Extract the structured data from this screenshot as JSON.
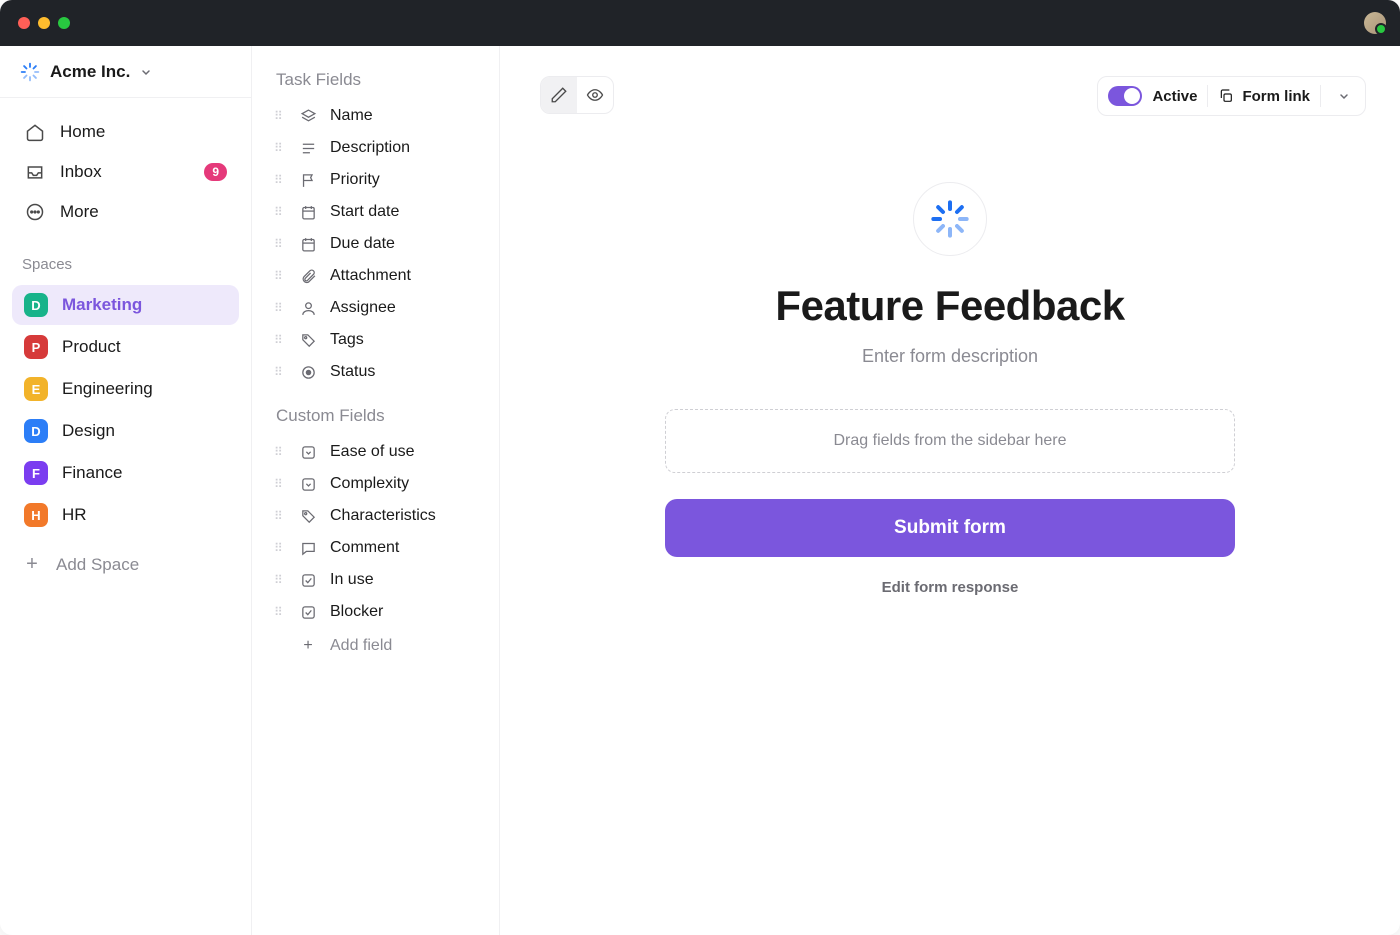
{
  "org": {
    "name": "Acme Inc."
  },
  "nav": {
    "home": "Home",
    "inbox": "Inbox",
    "inbox_badge": "9",
    "more": "More"
  },
  "spaces_heading": "Spaces",
  "spaces": [
    {
      "letter": "D",
      "label": "Marketing",
      "color": "#18b38a",
      "active": true
    },
    {
      "letter": "P",
      "label": "Product",
      "color": "#d63a3a",
      "active": false
    },
    {
      "letter": "E",
      "label": "Engineering",
      "color": "#f2b32a",
      "active": false
    },
    {
      "letter": "D",
      "label": "Design",
      "color": "#2c7ef7",
      "active": false
    },
    {
      "letter": "F",
      "label": "Finance",
      "color": "#7b3df0",
      "active": false
    },
    {
      "letter": "H",
      "label": "HR",
      "color": "#f2792a",
      "active": false
    }
  ],
  "add_space": "Add Space",
  "fields": {
    "task_heading": "Task Fields",
    "custom_heading": "Custom Fields",
    "task": [
      {
        "label": "Name",
        "icon": "layers"
      },
      {
        "label": "Description",
        "icon": "desc"
      },
      {
        "label": "Priority",
        "icon": "flag"
      },
      {
        "label": "Start date",
        "icon": "calendar"
      },
      {
        "label": "Due date",
        "icon": "calendar"
      },
      {
        "label": "Attachment",
        "icon": "clip"
      },
      {
        "label": "Assignee",
        "icon": "person"
      },
      {
        "label": "Tags",
        "icon": "tag"
      },
      {
        "label": "Status",
        "icon": "target"
      }
    ],
    "custom": [
      {
        "label": "Ease of use",
        "icon": "dropdown"
      },
      {
        "label": "Complexity",
        "icon": "dropdown"
      },
      {
        "label": "Characteristics",
        "icon": "tag"
      },
      {
        "label": "Comment",
        "icon": "comment"
      },
      {
        "label": "In use",
        "icon": "check"
      },
      {
        "label": "Blocker",
        "icon": "check"
      }
    ],
    "add_field": "Add field"
  },
  "toolbar": {
    "status": "Active",
    "form_link": "Form link"
  },
  "form": {
    "title": "Feature Feedback",
    "description_placeholder": "Enter form description",
    "drop_hint": "Drag fields from the sidebar here",
    "submit": "Submit form",
    "edit_response": "Edit form response"
  }
}
